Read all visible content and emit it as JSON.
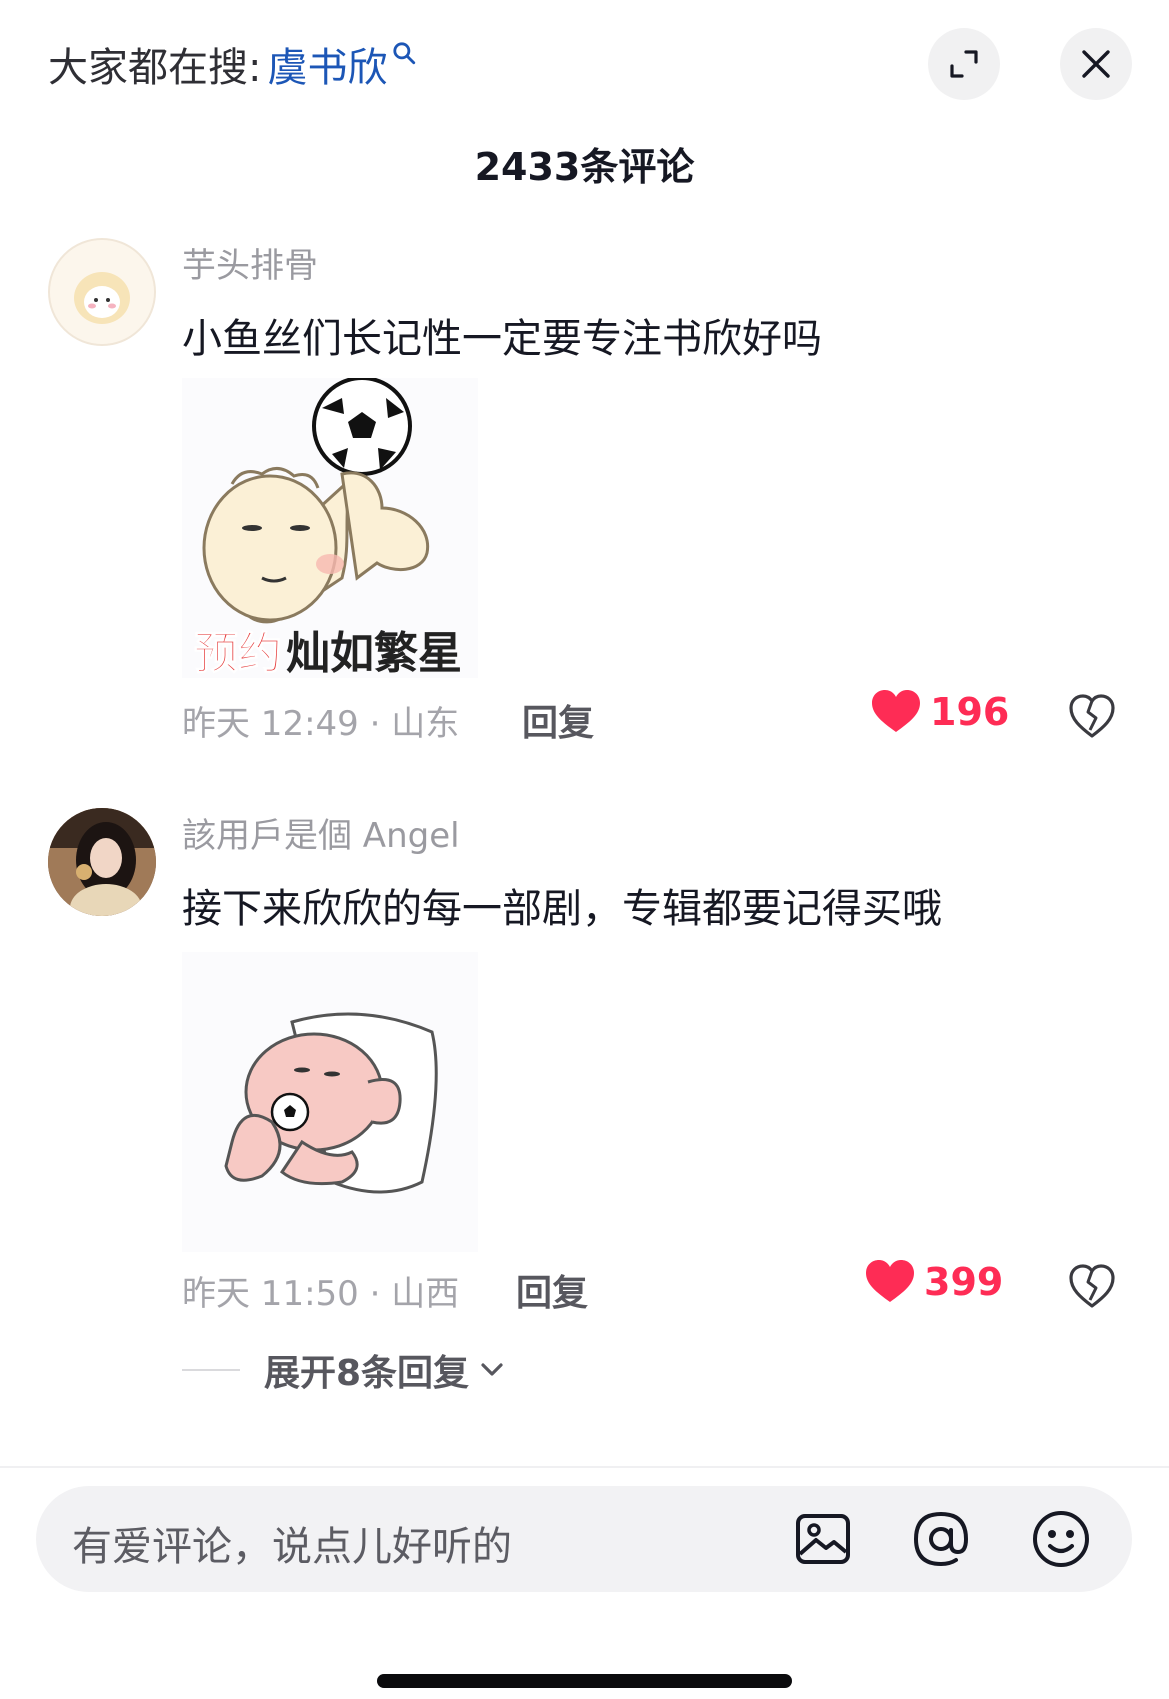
{
  "header": {
    "search_prefix": "大家都在搜:",
    "search_keyword": "虞书欣",
    "expand_icon": "expand-icon",
    "close_icon": "close-icon"
  },
  "comment_count": "2433条评论",
  "comments": [
    {
      "username": "芋头排骨",
      "text": "小鱼丝们长记性一定要专注书欣好吗",
      "sticker_caption_red": "预约",
      "sticker_caption": "灿如繁星",
      "meta": "昨天 12:49 · 山东",
      "reply_label": "回复",
      "likes": "196"
    },
    {
      "username": "該用戶是個 Angel",
      "text": "接下来欣欣的每一部剧，专辑都要记得买哦",
      "meta": "昨天 11:50 · 山西",
      "reply_label": "回复",
      "likes": "399",
      "expand_replies": "展开8条回复"
    }
  ],
  "input": {
    "placeholder": "有爱评论，说点儿好听的",
    "icons": [
      "image-icon",
      "at-icon",
      "emoji-icon"
    ]
  },
  "colors": {
    "accent_red": "#fe2c55",
    "keyword_blue": "#1c56b6"
  }
}
